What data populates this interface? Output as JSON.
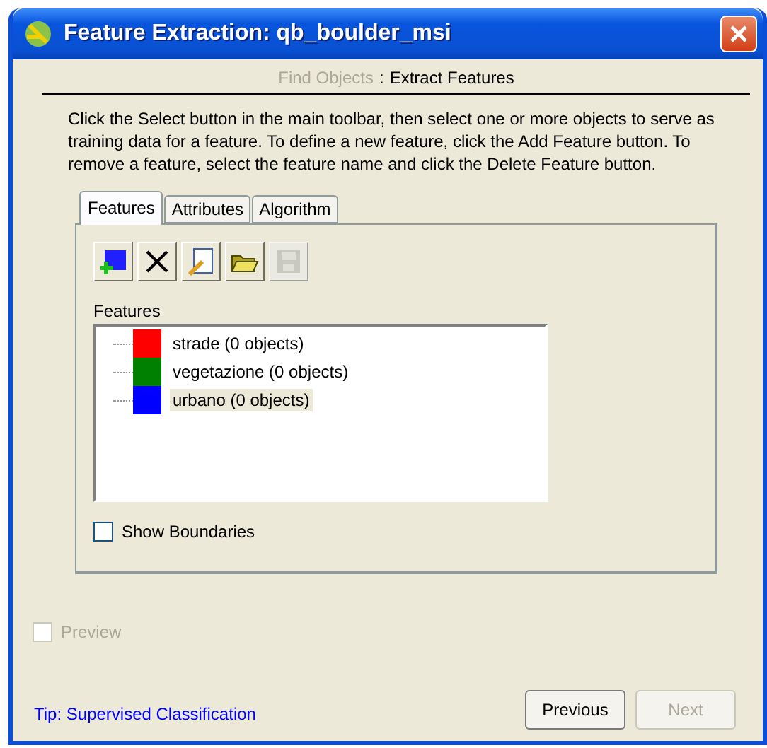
{
  "window": {
    "title": "Feature Extraction: qb_boulder_msi"
  },
  "breadcrumb": {
    "previous_step": "Find Objects",
    "separator": ":",
    "current_step": "Extract Features"
  },
  "instructions": "Click the Select button in the main toolbar, then select one or more objects to serve as training data for a feature. To define a new feature, click the Add Feature button. To remove a feature, select the feature name and click the Delete Feature button.",
  "tabs": [
    {
      "label": "Features",
      "selected": true
    },
    {
      "label": "Attributes",
      "selected": false
    },
    {
      "label": "Algorithm",
      "selected": false
    }
  ],
  "toolbar": [
    {
      "kind": "add",
      "disabled": false
    },
    {
      "kind": "delete",
      "disabled": false
    },
    {
      "kind": "edit",
      "disabled": false
    },
    {
      "kind": "open",
      "disabled": false
    },
    {
      "kind": "save",
      "disabled": true
    }
  ],
  "features_label": "Features",
  "features": [
    {
      "name": "strade (0 objects)",
      "color": "#ff0000",
      "selected": false
    },
    {
      "name": "vegetazione (0 objects)",
      "color": "#008000",
      "selected": false
    },
    {
      "name": "urbano (0 objects)",
      "color": "#0000ff",
      "selected": true
    }
  ],
  "show_boundaries": {
    "label": "Show Boundaries",
    "checked": false,
    "disabled": false
  },
  "preview": {
    "label": "Preview",
    "checked": false,
    "disabled": true
  },
  "tip": "Tip: Supervised Classification",
  "buttons": [
    {
      "label": "Previous",
      "disabled": false
    },
    {
      "label": "Next",
      "disabled": true
    }
  ]
}
